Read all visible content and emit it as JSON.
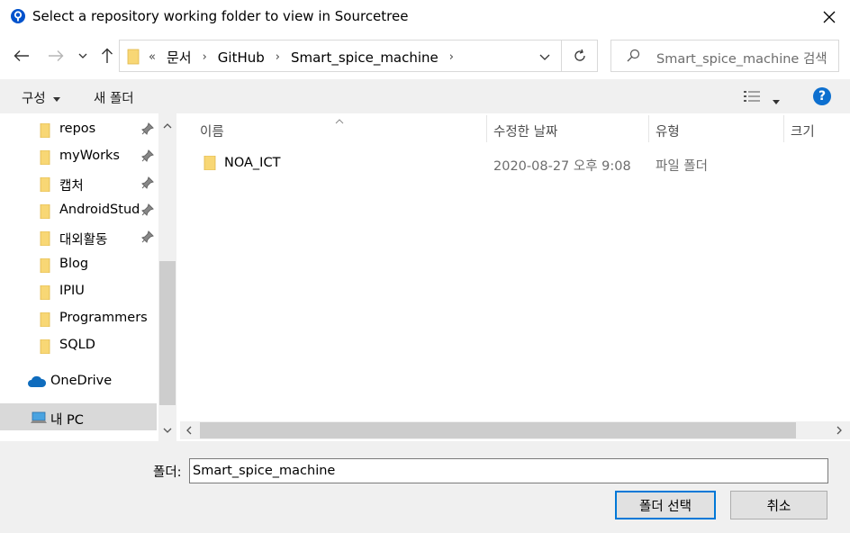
{
  "window": {
    "title": "Select a repository working folder to view in Sourcetree",
    "close_glyph": "✕"
  },
  "address": {
    "overflow": "«",
    "breadcrumbs": [
      "문서",
      "GitHub",
      "Smart_spice_machine"
    ],
    "search_placeholder": "Smart_spice_machine 검색"
  },
  "toolbar": {
    "organize": "구성",
    "new_folder": "새 폴더",
    "help": "?"
  },
  "nav": {
    "items": [
      {
        "label": "repos",
        "pinned": true
      },
      {
        "label": "myWorks",
        "pinned": true
      },
      {
        "label": "캡처",
        "pinned": true
      },
      {
        "label": "AndroidStudi",
        "pinned": true
      },
      {
        "label": "대외활동",
        "pinned": true
      },
      {
        "label": "Blog",
        "pinned": false
      },
      {
        "label": "IPIU",
        "pinned": false
      },
      {
        "label": "Programmers",
        "pinned": false
      },
      {
        "label": "SQLD",
        "pinned": false
      }
    ],
    "onedrive": "OneDrive",
    "this_pc": "내 PC"
  },
  "files": {
    "columns": {
      "name": "이름",
      "date": "수정한 날짜",
      "type": "유형",
      "size": "크기"
    },
    "rows": [
      {
        "name": "NOA_ICT",
        "date": "2020-08-27 오후 9:08",
        "type": "파일 폴더"
      }
    ]
  },
  "footer": {
    "folder_label": "폴더:",
    "folder_value": "Smart_spice_machine",
    "select_button": "폴더 선택",
    "cancel_button": "취소"
  },
  "colors": {
    "folder": "#f8d775",
    "accent": "#0078d7",
    "help": "#0d6fcf",
    "onedrive": "#0f6cbd"
  }
}
